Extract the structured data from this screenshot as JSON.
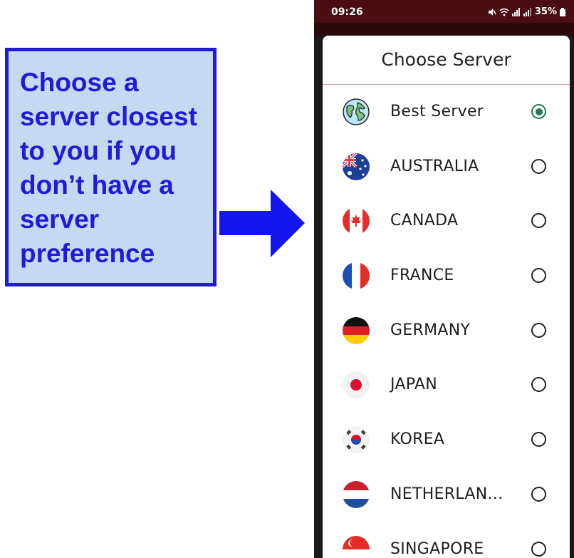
{
  "annotation": {
    "lines": [
      "Choose a",
      "server closest",
      "to you if you",
      "don’t have a",
      "server",
      "preference"
    ]
  },
  "status_bar": {
    "time": "09:26",
    "icons": [
      "mute-icon",
      "wifi-icon",
      "signal-icon",
      "signal-icon"
    ],
    "battery": "35%"
  },
  "sheet": {
    "title": "Choose Server"
  },
  "servers": [
    {
      "name": "Best Server",
      "flag": "globe-icon",
      "selected": true
    },
    {
      "name": "AUSTRALIA",
      "flag": "australia-flag-icon",
      "selected": false
    },
    {
      "name": "CANADA",
      "flag": "canada-flag-icon",
      "selected": false
    },
    {
      "name": "FRANCE",
      "flag": "france-flag-icon",
      "selected": false
    },
    {
      "name": "GERMANY",
      "flag": "germany-flag-icon",
      "selected": false
    },
    {
      "name": "JAPAN",
      "flag": "japan-flag-icon",
      "selected": false
    },
    {
      "name": "KOREA",
      "flag": "korea-flag-icon",
      "selected": false
    },
    {
      "name": "NETHERLAN...",
      "flag": "netherlands-flag-icon",
      "selected": false
    },
    {
      "name": "SINGAPORE",
      "flag": "singapore-flag-icon",
      "selected": false
    }
  ],
  "colors": {
    "callout_fill": "#c5d9f1",
    "callout_blue": "#1f1bd6",
    "status_bar": "#4a0d10",
    "radio_selected": "#1e7a4f"
  }
}
